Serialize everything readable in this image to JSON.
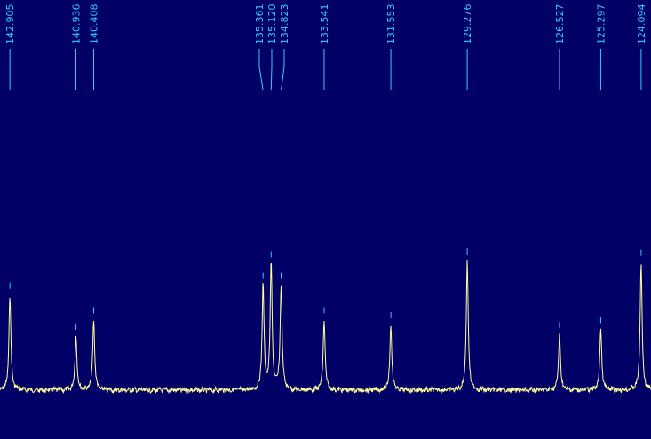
{
  "colors": {
    "background": "#000066",
    "label": "#33ccff",
    "trace": "#ffff99"
  },
  "chart_data": {
    "type": "line",
    "title": "",
    "xlabel": "",
    "ylabel": "",
    "x_axis_reversed": true,
    "xlim": [
      143.2,
      123.8
    ],
    "ylim": [
      0,
      1
    ],
    "grid": false,
    "peaks": [
      {
        "label": "142.905",
        "ppm": 142.905,
        "intensity": 0.58
      },
      {
        "label": "140.936",
        "ppm": 140.936,
        "intensity": 0.33
      },
      {
        "label": "140.408",
        "ppm": 140.408,
        "intensity": 0.43
      },
      {
        "label": "135.361",
        "ppm": 135.361,
        "intensity": 0.64
      },
      {
        "label": "135.120",
        "ppm": 135.12,
        "intensity": 0.77
      },
      {
        "label": "134.823",
        "ppm": 134.823,
        "intensity": 0.64
      },
      {
        "label": "133.541",
        "ppm": 133.541,
        "intensity": 0.43
      },
      {
        "label": "131.553",
        "ppm": 131.553,
        "intensity": 0.4
      },
      {
        "label": "129.276",
        "ppm": 129.276,
        "intensity": 0.79
      },
      {
        "label": "126.527",
        "ppm": 126.527,
        "intensity": 0.34
      },
      {
        "label": "125.297",
        "ppm": 125.297,
        "intensity": 0.37
      },
      {
        "label": "124.094",
        "ppm": 124.094,
        "intensity": 0.78
      }
    ]
  }
}
